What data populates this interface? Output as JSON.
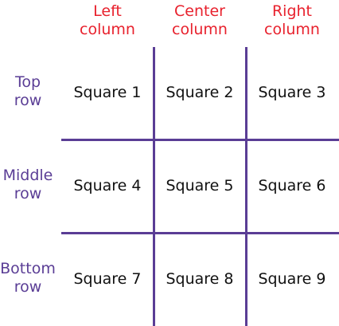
{
  "columns": [
    {
      "label": "Left\ncolumn"
    },
    {
      "label": "Center\ncolumn"
    },
    {
      "label": "Right\ncolumn"
    }
  ],
  "rows": [
    {
      "label": "Top\nrow"
    },
    {
      "label": "Middle\nrow"
    },
    {
      "label": "Bottom\nrow"
    }
  ],
  "cells": [
    "Square 1",
    "Square 2",
    "Square 3",
    "Square 4",
    "Square 5",
    "Square 6",
    "Square 7",
    "Square 8",
    "Square 9"
  ],
  "colors": {
    "column_header": "#e8212d",
    "row_header": "#5a3d95",
    "grid": "#5a3d95",
    "cell_text": "#111111"
  }
}
